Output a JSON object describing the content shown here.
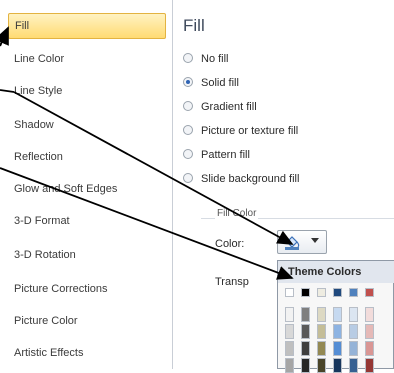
{
  "nav": {
    "items": [
      {
        "label": "Fill",
        "selected": true
      },
      {
        "label": "Line Color"
      },
      {
        "label": "Line Style"
      },
      {
        "label": "Shadow"
      },
      {
        "label": "Reflection"
      },
      {
        "label": "Glow and Soft Edges"
      },
      {
        "label": "3-D Format"
      },
      {
        "label": "3-D Rotation"
      },
      {
        "label": "Picture Corrections"
      },
      {
        "label": "Picture Color"
      },
      {
        "label": "Artistic Effects"
      }
    ]
  },
  "panel": {
    "title": "Fill",
    "options": [
      {
        "label": "No fill",
        "checked": false
      },
      {
        "label": "Solid fill",
        "checked": true
      },
      {
        "label": "Gradient fill",
        "checked": false
      },
      {
        "label": "Picture or texture fill",
        "checked": false
      },
      {
        "label": "Pattern fill",
        "checked": false
      },
      {
        "label": "Slide background fill",
        "checked": false
      }
    ],
    "fill_color_group_label": "Fill Color",
    "color_label": "Color:",
    "transparency_label": "Transp",
    "color_button_icon": "paint-bucket-icon",
    "color_button_arrow": "dropdown-arrow-icon"
  },
  "dropdown": {
    "header": "Theme Colors",
    "top_row": [
      "#ffffff",
      "#000000",
      "#eeece1",
      "#1f497d",
      "#4f81bd",
      "#c0504d"
    ],
    "shade_columns": [
      [
        "#f2f2f2",
        "#d8d8d8",
        "#bfbfbf",
        "#a5a5a5"
      ],
      [
        "#7f7f7f",
        "#595959",
        "#3f3f3f",
        "#262626"
      ],
      [
        "#ddd9c3",
        "#c4bd97",
        "#938953",
        "#494429"
      ],
      [
        "#c6d9f0",
        "#8db3e2",
        "#548dd4",
        "#17365d"
      ],
      [
        "#dbe5f1",
        "#b8cce4",
        "#95b3d7",
        "#366092"
      ],
      [
        "#f2dcdb",
        "#e5b9b7",
        "#d99694",
        "#953734"
      ]
    ]
  },
  "colors": {
    "selected_bg": "#ffdb73",
    "accent_arrow": "#000000"
  }
}
